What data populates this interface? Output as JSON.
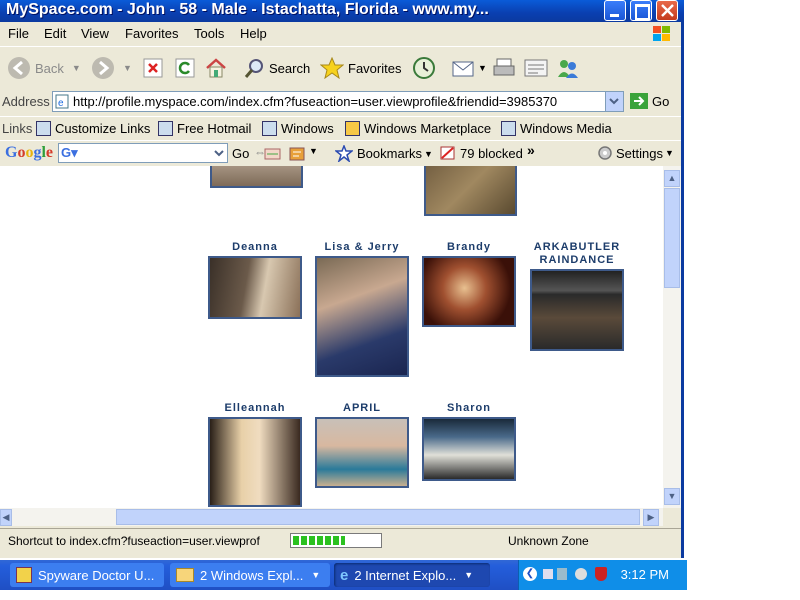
{
  "window": {
    "title": "MySpace.com - John - 58 - Male - Istachatta, Florida - www.my..."
  },
  "menu": [
    "File",
    "Edit",
    "View",
    "Favorites",
    "Tools",
    "Help"
  ],
  "toolbar": {
    "back": "Back",
    "search": "Search",
    "favorites": "Favorites"
  },
  "address": {
    "label": "Address",
    "url": "http://profile.myspace.com/index.cfm?fuseaction=user.viewprofile&friendid=3985370",
    "go": "Go"
  },
  "links": {
    "label": "Links",
    "items": [
      "Customize Links",
      "Free Hotmail",
      "Windows",
      "Windows Marketplace",
      "Windows Media"
    ]
  },
  "google": {
    "logo": "Google",
    "go": "Go",
    "bookmarks": "Bookmarks",
    "blocked": "79 blocked",
    "settings": "Settings"
  },
  "friends": [
    {
      "name": "Deanna"
    },
    {
      "name": "Lisa & Jerry"
    },
    {
      "name": "Brandy"
    },
    {
      "name": "ARKABUTLER RAINDANCE"
    },
    {
      "name": "Elleannah"
    },
    {
      "name": "APRIL"
    },
    {
      "name": "Sharon"
    }
  ],
  "status": {
    "text": "Shortcut to index.cfm?fuseaction=user.viewprof",
    "zone": "Unknown Zone",
    "progress": 0.6
  },
  "taskbar": {
    "items": [
      "Spyware Doctor U...",
      "2 Windows Expl...",
      "2 Internet Explo..."
    ],
    "clock": "3:12 PM"
  },
  "colors": {
    "title_bar": "#0a4fc8",
    "friend_name": "#1d3d6b",
    "taskbar": "#245edb"
  }
}
